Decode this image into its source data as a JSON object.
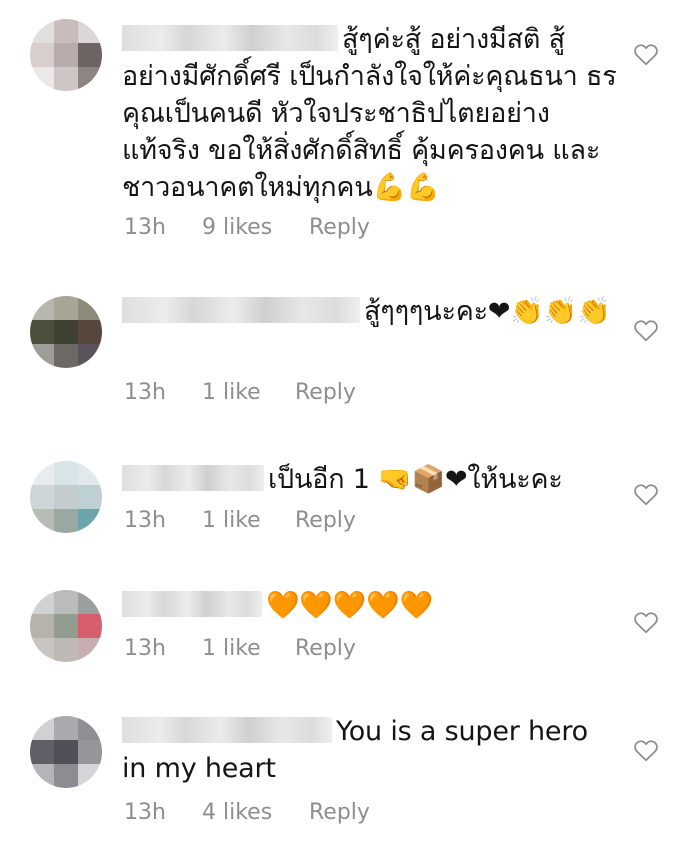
{
  "comments": [
    {
      "text": "สู้ๆค่ะสู้ อย่างมีสติ สู้ อย่างมีศักดิ์ศรี เป็นกำลังใจให้ค่ะคุณธนา ธร คุณเป็นคนดี หัวใจประชาธิปไตยอย่าง แท้จริง ขอให้สิ่งศักดิ์สิทธิ์ คุ้มครองคน และ ชาวอนาคตใหม่ทุกคน💪💪",
      "time": "13h",
      "likes": "9 likes",
      "reply": "Reply",
      "avatar_colors": [
        "#e3dede",
        "#c9bdbc",
        "#dcd6d6",
        "#d8cecd",
        "#b7abab",
        "#6e6464",
        "#ece8e8",
        "#cfc5c5",
        "#8d8484"
      ]
    },
    {
      "text": "สู้ๆๆๆนะคะ❤👏👏👏",
      "time": "13h",
      "likes": "1 like",
      "reply": "Reply",
      "avatar_colors": [
        "#b8b7ad",
        "#a7a695",
        "#8e8a7c",
        "#4d4f3c",
        "#3f4233",
        "#57473d",
        "#9e9d97",
        "#6d6a66",
        "#5c545c"
      ]
    },
    {
      "text": "เป็นอีก 1 🤜📦❤ให้นะคะ",
      "time": "13h",
      "likes": "1 like",
      "reply": "Reply",
      "avatar_colors": [
        "#e7ecee",
        "#d9e4e8",
        "#e2e9ec",
        "#cfd6d8",
        "#c5ccce",
        "#bfd0d5",
        "#b5bdb4",
        "#9ba8a2",
        "#6ca4ad"
      ]
    },
    {
      "text": "🧡🧡🧡🧡🧡",
      "time": "13h",
      "likes": "1 like",
      "reply": "Reply",
      "avatar_colors": [
        "#cfd1d2",
        "#b9bcbb",
        "#9c9fa0",
        "#b7b2aa",
        "#939d8f",
        "#d75e6c",
        "#c9c6c1",
        "#bdbab5",
        "#c7afb1"
      ]
    },
    {
      "text": "You is a super hero in my heart",
      "time": "13h",
      "likes": "4 likes",
      "reply": "Reply",
      "avatar_colors": [
        "#d0d1d3",
        "#a9aaae",
        "#8e8f94",
        "#5e6067",
        "#4f5158",
        "#95969b",
        "#b4b5b9",
        "#8c8d92",
        "#d4d5d8"
      ]
    }
  ]
}
